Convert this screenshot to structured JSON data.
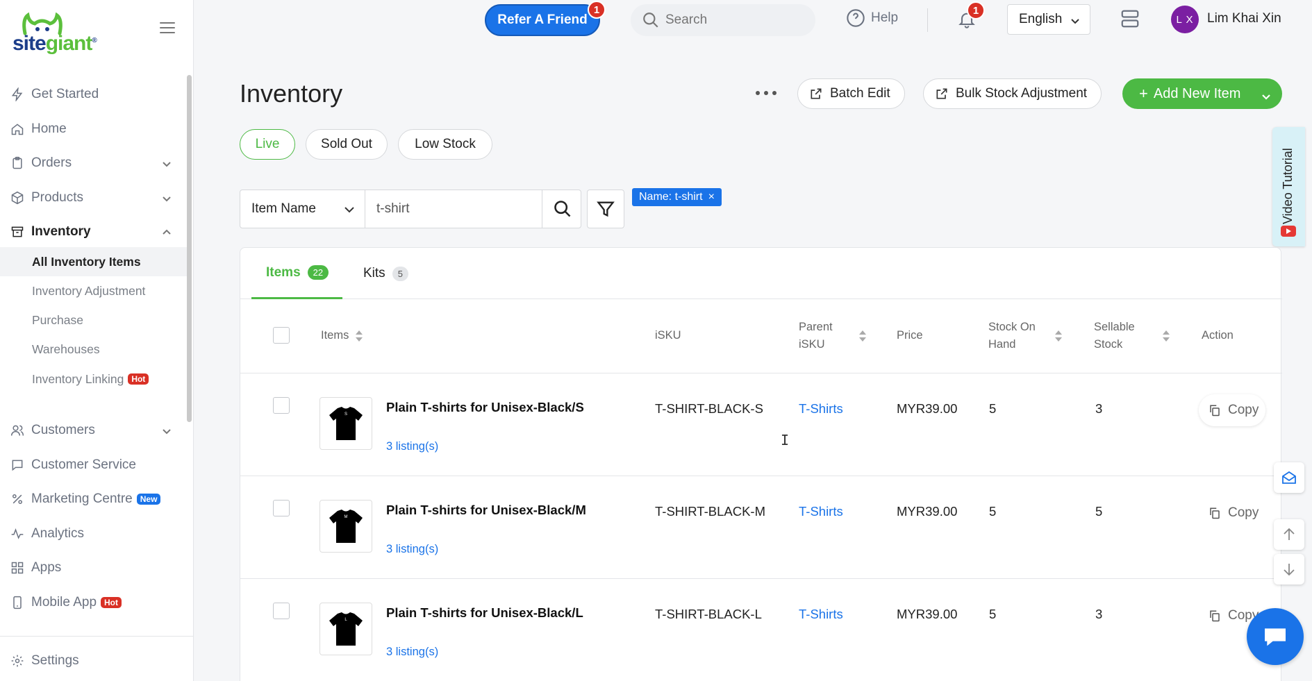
{
  "brand": {
    "logo_main": "site",
    "logo_accent": "giant",
    "logo_reg": "®"
  },
  "topbar": {
    "refer_label": "Refer A Friend",
    "refer_badge": "1",
    "search_placeholder": "Search",
    "help_label": "Help",
    "bell_badge": "1",
    "language": "English",
    "avatar_initials": "L X",
    "user_name": "Lim Khai Xin"
  },
  "sidebar": {
    "items": [
      {
        "label": "Get Started",
        "icon": "bolt-icon"
      },
      {
        "label": "Home",
        "icon": "home-icon"
      },
      {
        "label": "Orders",
        "icon": "clipboard-icon"
      },
      {
        "label": "Products",
        "icon": "box-icon"
      },
      {
        "label": "Inventory",
        "icon": "archive-icon"
      },
      {
        "label": "Customers",
        "icon": "users-icon"
      },
      {
        "label": "Customer Service",
        "icon": "chat-icon"
      },
      {
        "label": "Marketing Centre",
        "icon": "percent-icon",
        "badge": "New"
      },
      {
        "label": "Analytics",
        "icon": "pulse-icon"
      },
      {
        "label": "Apps",
        "icon": "grid-icon"
      },
      {
        "label": "Mobile App",
        "icon": "phone-icon",
        "badge": "Hot"
      },
      {
        "label": "Settings",
        "icon": "gear-icon"
      }
    ],
    "inventory_sub": [
      {
        "label": "All Inventory Items"
      },
      {
        "label": "Inventory Adjustment"
      },
      {
        "label": "Purchase"
      },
      {
        "label": "Warehouses"
      },
      {
        "label": "Inventory Linking",
        "badge": "Hot"
      }
    ]
  },
  "page": {
    "title": "Inventory",
    "batch_edit": "Batch Edit",
    "bulk_stock": "Bulk Stock Adjustment",
    "add_new": "Add New Item",
    "status_pills": [
      "Live",
      "Sold Out",
      "Low Stock"
    ],
    "video_tutorial": "Video Tutorial"
  },
  "filter": {
    "field": "Item Name",
    "value": "t-shirt",
    "chip": "Name: t-shirt",
    "chip_close": "×"
  },
  "tabs": [
    {
      "label": "Items",
      "count": "22"
    },
    {
      "label": "Kits",
      "count": "5"
    }
  ],
  "table": {
    "headers": {
      "items": "Items",
      "isku": "iSKU",
      "parent_isku_1": "Parent",
      "parent_isku_2": "iSKU",
      "price": "Price",
      "stock_on_hand_1": "Stock On",
      "stock_on_hand_2": "Hand",
      "sellable_1": "Sellable",
      "sellable_2": "Stock",
      "action": "Action"
    },
    "rows": [
      {
        "name": "Plain T-shirts for Unisex-Black/S",
        "size_mark": "S",
        "listings": "3 listing(s)",
        "isku": "T-SHIRT-BLACK-S",
        "parent": "T-Shirts",
        "price": "MYR39.00",
        "stock_on_hand": "5",
        "sellable": "3",
        "action": "Copy"
      },
      {
        "name": "Plain T-shirts for Unisex-Black/M",
        "size_mark": "M",
        "listings": "3 listing(s)",
        "isku": "T-SHIRT-BLACK-M",
        "parent": "T-Shirts",
        "price": "MYR39.00",
        "stock_on_hand": "5",
        "sellable": "5",
        "action": "Copy"
      },
      {
        "name": "Plain T-shirts for Unisex-Black/L",
        "size_mark": "L",
        "listings": "3 listing(s)",
        "isku": "T-SHIRT-BLACK-L",
        "parent": "T-Shirts",
        "price": "MYR39.00",
        "stock_on_hand": "5",
        "sellable": "3",
        "action": "Copy"
      }
    ]
  },
  "colors": {
    "accent_green": "#4cb944",
    "brand_blue": "#1a73e8",
    "badge_red": "#d93025"
  }
}
